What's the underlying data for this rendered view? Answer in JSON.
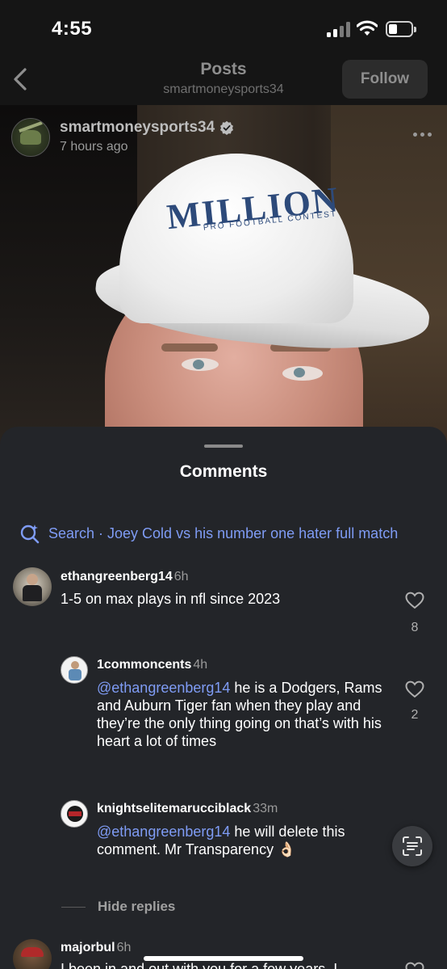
{
  "status_bar": {
    "time": "4:55"
  },
  "header": {
    "title": "Posts",
    "subtitle": "smartmoneysports34",
    "follow_label": "Follow"
  },
  "post": {
    "username": "smartmoneysports34",
    "time_ago": "7 hours ago",
    "verified": true,
    "hat_text": "MILLION",
    "hat_subtext": "PRO FOOTBALL CONTEST"
  },
  "comments_sheet": {
    "title": "Comments",
    "search_text": "Search · Joey Cold vs his number one hater full match",
    "hide_replies_label": "Hide replies",
    "comments": [
      {
        "username": "ethangreenberg14",
        "age": "6h",
        "text": "1-5 on max plays in nfl since 2023",
        "likes": "8"
      }
    ],
    "replies": [
      {
        "username": "1commoncents",
        "age": "4h",
        "mention": "@ethangreenberg14",
        "text": " he is a Dodgers, Rams and Auburn Tiger fan when they play and they’re the only thing going on that’s with his heart a lot of times",
        "likes": "2"
      },
      {
        "username": "knightselitemarucciblack",
        "age": "33m",
        "mention": "@ethangreenberg14",
        "text": " he will delete this comment. Mr Transparency 👌🏻"
      }
    ],
    "next_comment": {
      "username": "majorbul",
      "age": "6h",
      "text": "I been in and out with you for a few years. I"
    }
  },
  "colors": {
    "sheet_bg": "#232529",
    "link_blue": "#7f9cf5",
    "muted_gray": "#9a9a9a"
  }
}
